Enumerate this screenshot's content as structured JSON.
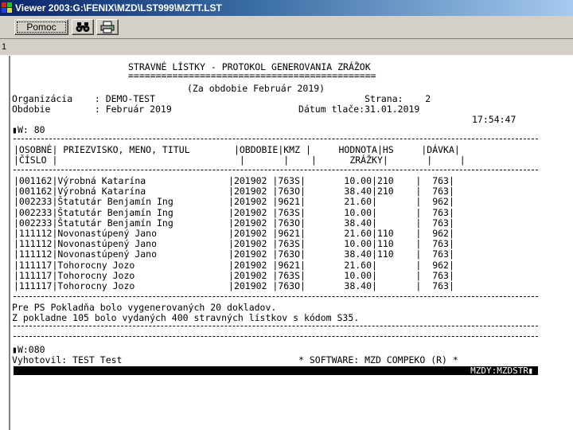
{
  "window": {
    "title": "Viewer 2003:G:\\FENIX\\MZD\\LST999\\MZTT.LST"
  },
  "toolbar": {
    "help_label": "Pomoc"
  },
  "pagebar": {
    "page": "1"
  },
  "report": {
    "title": "STRAVNÉ LÍSTKY - PROTOKOL GENEROVANIA ZRÁŽOK",
    "title_underline": "=============================================",
    "period_line": "(Za obdobie Február 2019)",
    "org_line": "Organizácia    : DEMO-TEST                                      Strana:    2",
    "obdobie_line": "Obdobie        : Február 2019                       Dátum tlače:31.01.2019",
    "time_line": "17:54:47",
    "w_line": "W: 80",
    "header_line1": "|OSOBNÉ| PRIEZVISKO, MENO, TITUL        |OBDOBIE|KMZ |     HODNOTA|HS     |DÁVKA|",
    "header_line2": "|ČÍSLO |                                 |       |    |      ZRÁŽKY|       |     |",
    "rows": [
      "|001162|Výrobná Katarína               |201902 |763S|       10.00|210    |  763|",
      "|001162|Výrobná Katarína               |201902 |763O|       38.40|210    |  763|",
      "|002233|Štatutár Benjamín Ing          |201902 |9621|       21.60|       |  962|",
      "|002233|Štatutár Benjamín Ing          |201902 |763S|       10.00|       |  763|",
      "|002233|Štatutár Benjamín Ing          |201902 |763O|       38.40|       |  763|",
      "|111112|Novonastúpený Jano             |201902 |9621|       21.60|110    |  962|",
      "|111112|Novonastúpený Jano             |201902 |763S|       10.00|110    |  763|",
      "|111112|Novonastúpený Jano             |201902 |763O|       38.40|110    |  763|",
      "|111117|Tohorocny Jozo                 |201902 |9621|       21.60|       |  962|",
      "|111117|Tohorocny Jozo                 |201902 |763S|       10.00|       |  763|",
      "|111117|Tohorocny Jozo                 |201902 |763O|       38.40|       |  763|"
    ],
    "summary1": "Pre PS Pokladňa bolo vygenerovaných 20 dokladov.",
    "summary2": "Z pokladne 105 bolo vydaných 400 stravných lístkov s kódom S35.",
    "w_line2": "W:080",
    "footer": "Vyhotovil: TEST Test                                * SOFTWARE: MZD COMPEKO (R) *",
    "status": "MZDY:MZDSTR"
  },
  "icons": {
    "app": "viewer-app-icon",
    "find": "binoculars-icon",
    "print": "printer-icon"
  }
}
